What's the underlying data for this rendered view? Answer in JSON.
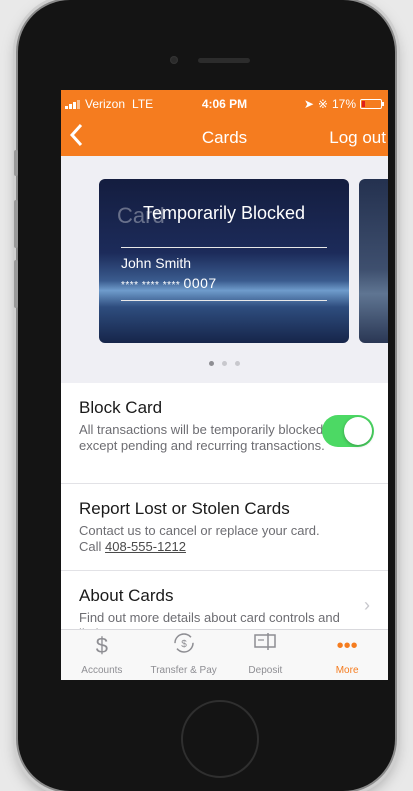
{
  "status_bar": {
    "carrier": "Verizon",
    "network": "LTE",
    "time": "4:06 PM",
    "battery": "17%"
  },
  "nav": {
    "back_icon": "chevron-left",
    "title": "Cards",
    "logout": "Log out"
  },
  "card": {
    "ghost_label": "Card",
    "status": "Temporarily Blocked",
    "holder": "John Smith",
    "masked": "**** **** ****",
    "last4": "0007"
  },
  "carousel": {
    "pages": 3,
    "active_page": 1
  },
  "rows": {
    "block": {
      "title": "Block Card",
      "description": "All transactions will be temporarily blocked except pending and recurring transactions.",
      "toggle_on": true
    },
    "report": {
      "title": "Report Lost or Stolen Cards",
      "description": "Contact us to cancel or replace your card.",
      "call_prefix": "Call",
      "phone": "408-555-1212"
    },
    "about": {
      "title": "About Cards",
      "description": "Find out more details about card controls and limits"
    }
  },
  "tabs": [
    {
      "label": "Accounts",
      "icon": "dollar-icon"
    },
    {
      "label": "Transfer & Pay",
      "icon": "transfer-icon"
    },
    {
      "label": "Deposit",
      "icon": "deposit-icon"
    },
    {
      "label": "More",
      "icon": "more-icon"
    }
  ],
  "colors": {
    "accent": "#f57c1f",
    "toggle": "#4cd964"
  }
}
